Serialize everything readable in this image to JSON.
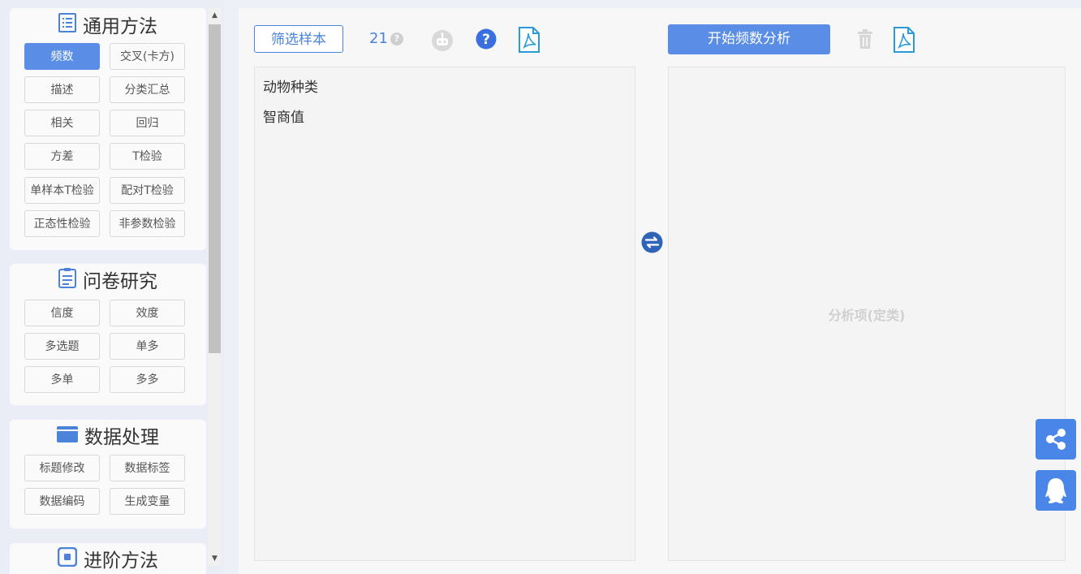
{
  "sidebar": {
    "sections": [
      {
        "title": "通用方法",
        "icon": "list-icon",
        "buttons": [
          "频数",
          "交叉(卡方)",
          "描述",
          "分类汇总",
          "相关",
          "回归",
          "方差",
          "T检验",
          "单样本T检验",
          "配对T检验",
          "正态性检验",
          "非参数检验"
        ],
        "active": "频数"
      },
      {
        "title": "问卷研究",
        "icon": "clipboard-icon",
        "buttons": [
          "信度",
          "效度",
          "多选题",
          "单多",
          "多单",
          "多多"
        ]
      },
      {
        "title": "数据处理",
        "icon": "folder-icon",
        "buttons": [
          "标题修改",
          "数据标签",
          "数据编码",
          "生成变量"
        ]
      },
      {
        "title": "进阶方法",
        "icon": "advanced-icon",
        "buttons": []
      }
    ]
  },
  "toolbar": {
    "filter_label": "筛选样本",
    "sample_count": "21",
    "start_label": "开始频数分析"
  },
  "variables": [
    "动物种类",
    "智商值"
  ],
  "analysis_panel": {
    "placeholder": "分析项(定类)"
  },
  "colors": {
    "accent": "#5a8de6",
    "link": "#4a83d9",
    "pdf": "#2a9ad8"
  }
}
